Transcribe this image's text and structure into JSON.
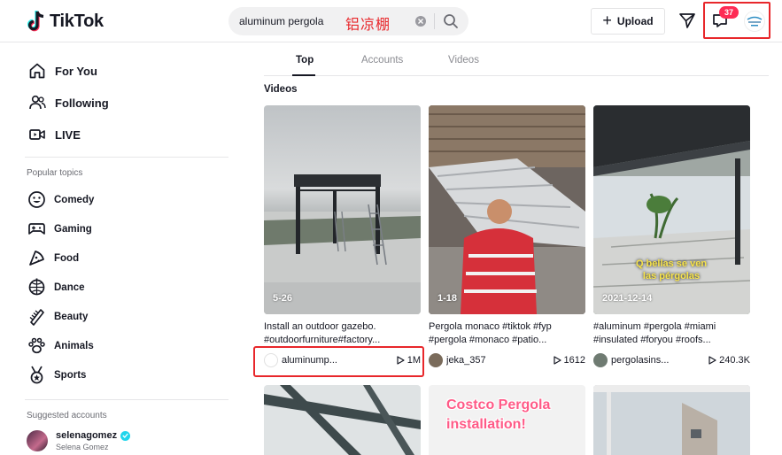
{
  "header": {
    "logo_text": "TikTok",
    "search_value": "aluminum pergola",
    "search_annotation": "铝凉棚",
    "upload_label": "Upload",
    "inbox_badge": "37"
  },
  "sidebar": {
    "nav": [
      {
        "label": "For You",
        "icon": "home-icon"
      },
      {
        "label": "Following",
        "icon": "people-icon"
      },
      {
        "label": "LIVE",
        "icon": "live-icon"
      }
    ],
    "popular_topics_title": "Popular topics",
    "topics": [
      {
        "label": "Comedy",
        "icon": "smile-icon"
      },
      {
        "label": "Gaming",
        "icon": "gamepad-icon"
      },
      {
        "label": "Food",
        "icon": "food-icon"
      },
      {
        "label": "Dance",
        "icon": "dance-icon"
      },
      {
        "label": "Beauty",
        "icon": "comb-icon"
      },
      {
        "label": "Animals",
        "icon": "paw-icon"
      },
      {
        "label": "Sports",
        "icon": "medal-icon"
      }
    ],
    "suggested_title": "Suggested accounts",
    "suggested": [
      {
        "name": "selenagomez",
        "sub": "Selena Gomez"
      }
    ]
  },
  "main": {
    "tabs": [
      "Top",
      "Accounts",
      "Videos"
    ],
    "section_label": "Videos",
    "videos": [
      {
        "date": "5-26",
        "desc1": "Install an outdoor gazebo.",
        "desc2": "#outdoorfurniture#factory...",
        "author": "aluminump...",
        "views": "1M"
      },
      {
        "date": "1-18",
        "desc1": "Pergola monaco #tiktok #fyp",
        "desc2": "#pergola #monaco #patio...",
        "author": "jeka_357",
        "views": "1612"
      },
      {
        "date": "2021-12-14",
        "desc1": "#aluminum #pergola #miami",
        "desc2": "#insulated #foryou #roofs...",
        "author": "pergolasins...",
        "views": "240.3K",
        "overlay": "Q bellas se ven las pérgolas"
      }
    ],
    "row2_overlay": "Costco Pergola installation!"
  },
  "colors": {
    "accent": "#fe2c55",
    "annotation_red": "#e8272b",
    "text": "#161823",
    "muted": "#8a8b91"
  }
}
